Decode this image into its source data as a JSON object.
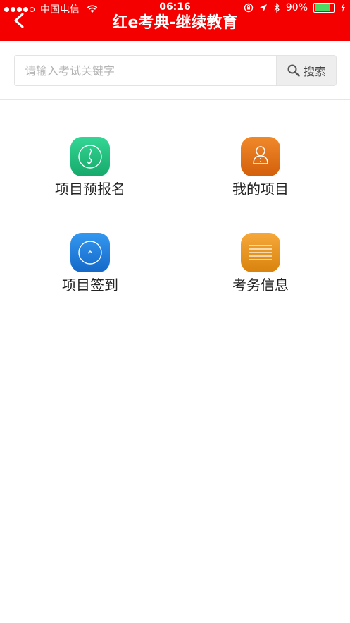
{
  "status_bar": {
    "carrier": "中国电信",
    "time": "06:16",
    "battery": "90%",
    "battery_level": 0.9
  },
  "header": {
    "title": "红e考典-继续教育",
    "back_icon": "chevron-left-icon",
    "background_color": "#f40000"
  },
  "search": {
    "placeholder": "请输入考试关键字",
    "value": "",
    "button_label": "搜索",
    "button_icon": "search-icon"
  },
  "menu": [
    {
      "label": "项目预报名",
      "icon": "enroll-icon",
      "color": "#1fbf7e"
    },
    {
      "label": "我的项目",
      "icon": "person-icon",
      "color": "#e8771a"
    },
    {
      "label": "项目签到",
      "icon": "check-in-icon",
      "color": "#1a7de0"
    },
    {
      "label": "考务信息",
      "icon": "list-icon",
      "color": "#e8951a"
    }
  ]
}
